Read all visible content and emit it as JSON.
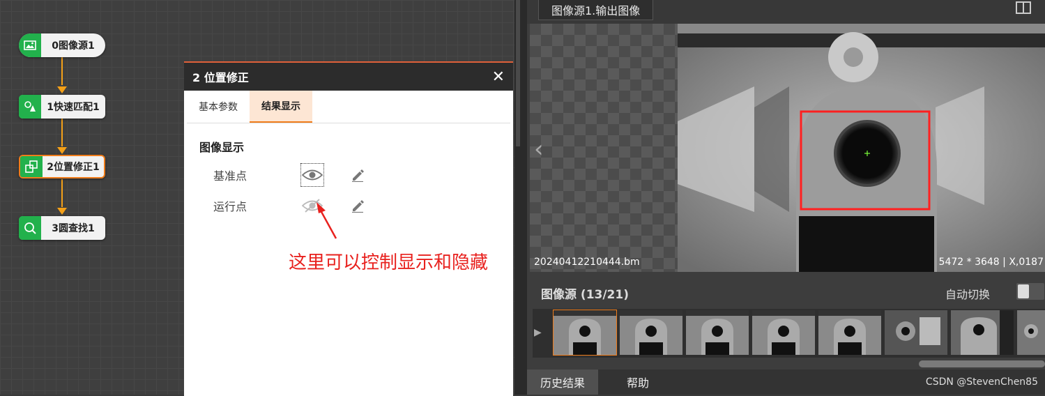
{
  "flow": {
    "nodes": [
      {
        "label": "0图像源1",
        "icon": "image-icon"
      },
      {
        "label": "1快速匹配1",
        "icon": "shape-match-icon"
      },
      {
        "label": "2位置修正1",
        "icon": "position-fix-icon",
        "selected": true
      },
      {
        "label": "3圆查找1",
        "icon": "circle-find-icon"
      }
    ]
  },
  "dialog": {
    "title": "2 位置修正",
    "close": "✕",
    "tabs": [
      {
        "label": "基本参数",
        "active": false
      },
      {
        "label": "结果显示",
        "active": true
      }
    ],
    "section_title": "图像显示",
    "rows": [
      {
        "label": "基准点",
        "visible": true
      },
      {
        "label": "运行点",
        "visible": false
      }
    ],
    "annotation": "这里可以控制显示和隐藏"
  },
  "viewer": {
    "tab_label": "图像源1.输出图像",
    "filename": "20240412210444.bm",
    "resolution": "5472 * 3648  |  X,0187"
  },
  "source": {
    "title": "图像源 (13/21)",
    "auto_switch_label": "自动切换"
  },
  "bottom_tabs": {
    "history": "历史结果",
    "help": "帮助"
  },
  "watermark": "CSDN @StevenChen85",
  "colors": {
    "accent_orange": "#f07d1b",
    "node_green": "#22b14c",
    "annotation_red": "#e8211e",
    "roi_red": "#ff2020"
  }
}
